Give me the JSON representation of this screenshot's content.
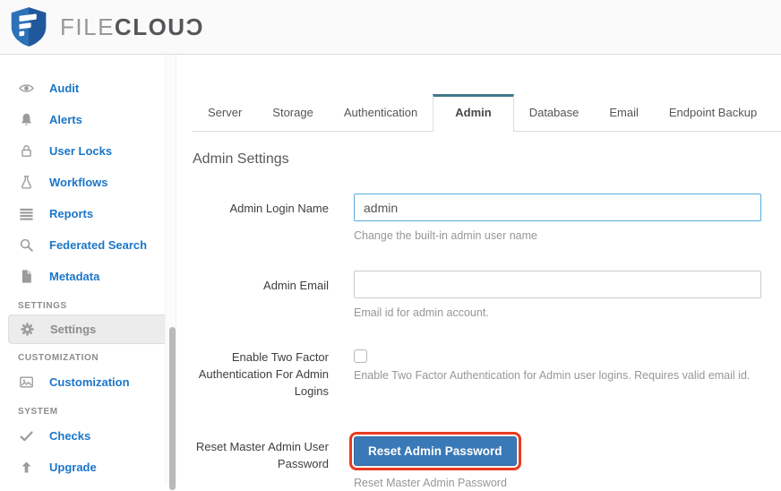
{
  "brand": {
    "name_light": "FILE",
    "name_bold": "CLOUƆ"
  },
  "colors": {
    "link_blue": "#1b76c8",
    "icon_gray": "#9b9b9b",
    "tab_active_accent": "#41798b",
    "button_blue": "#3a79b7",
    "highlight_red": "#e73b21",
    "input_focus_blue": "#57abdc"
  },
  "sidebar": {
    "items": [
      {
        "label": "Audit",
        "icon": "eye-icon"
      },
      {
        "label": "Alerts",
        "icon": "bell-icon"
      },
      {
        "label": "User Locks",
        "icon": "lock-icon"
      },
      {
        "label": "Workflows",
        "icon": "flask-icon"
      },
      {
        "label": "Reports",
        "icon": "list-icon"
      },
      {
        "label": "Federated Search",
        "icon": "search-icon"
      },
      {
        "label": "Metadata",
        "icon": "file-icon"
      }
    ],
    "sections": [
      {
        "header": "SETTINGS",
        "items": [
          {
            "label": "Settings",
            "icon": "gear-icon",
            "active": true
          }
        ]
      },
      {
        "header": "CUSTOMIZATION",
        "items": [
          {
            "label": "Customization",
            "icon": "image-icon",
            "active": false
          }
        ]
      },
      {
        "header": "SYSTEM",
        "items": [
          {
            "label": "Checks",
            "icon": "check-icon",
            "active": false
          },
          {
            "label": "Upgrade",
            "icon": "arrow-up-icon",
            "active": false
          }
        ]
      }
    ]
  },
  "tabs": {
    "active": "Admin",
    "items": [
      "Server",
      "Storage",
      "Authentication",
      "Admin",
      "Database",
      "Email",
      "Endpoint Backup"
    ]
  },
  "page": {
    "title": "Admin Settings"
  },
  "form": {
    "rows": [
      {
        "label": "Admin Login Name",
        "type": "text",
        "value": "admin",
        "help": "Change the built-in admin user name",
        "focused": true
      },
      {
        "label": "Admin Email",
        "type": "text",
        "value": "",
        "help": "Email id for admin account.",
        "focused": false
      },
      {
        "label": "Enable Two Factor Authentication For Admin Logins",
        "type": "checkbox",
        "checked": false,
        "help": "Enable Two Factor Authentication for Admin user logins. Requires valid email id."
      },
      {
        "label": "Reset Master Admin User Password",
        "type": "button",
        "button_label": "Reset Admin Password",
        "help": "Reset Master Admin Password",
        "highlighted": true
      }
    ]
  }
}
